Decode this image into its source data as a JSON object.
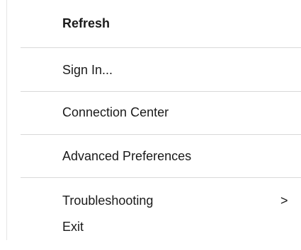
{
  "menu": {
    "items": [
      {
        "label": "Refresh",
        "bold": true
      },
      {
        "label": "Sign In..."
      },
      {
        "label": "Connection Center"
      },
      {
        "label": "Advanced Preferences"
      },
      {
        "label": "Troubleshooting",
        "submenu_indicator": ">"
      },
      {
        "label": "Exit"
      }
    ]
  },
  "icons": {
    "submenu": "chevron-right-icon"
  }
}
